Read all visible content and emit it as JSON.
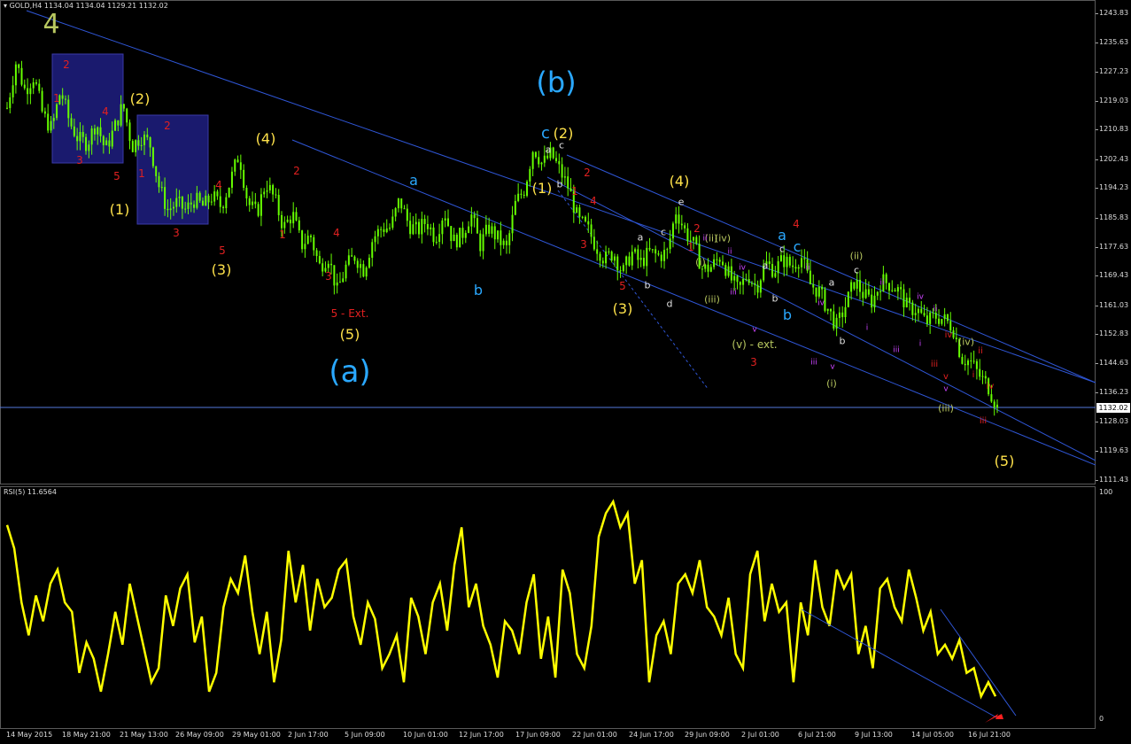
{
  "header": {
    "symbol": "GOLD,H4",
    "ohlc": "1134.04 1134.04 1129.21 1132.02"
  },
  "rsi_header": "RSI(5) 11.6564",
  "current_price": "1132.02",
  "colors": {
    "candle": "#66ff00",
    "rsi": "#ffff00",
    "channel": "#2f56d6",
    "box": "#1a1a6e",
    "red": "#e02020",
    "yellow": "#ffe24a",
    "blue": "#2aa8ff",
    "white": "#e0e0e0",
    "magenta": "#cc44ff",
    "olive": "#b8c860"
  },
  "chart_data": [
    {
      "type": "candlestick",
      "symbol": "GOLD",
      "timeframe": "H4",
      "y_ticks": [
        "1243.83",
        "1235.63",
        "1227.23",
        "1219.03",
        "1210.83",
        "1202.43",
        "1194.23",
        "1185.83",
        "1177.63",
        "1169.43",
        "1161.03",
        "1152.83",
        "1144.63",
        "1136.23",
        "1128.03",
        "1119.63",
        "1111.43"
      ],
      "x_ticks": [
        "14 May 2015",
        "18 May 21:00",
        "21 May 13:00",
        "26 May 09:00",
        "29 May 01:00",
        "2 Jun 17:00",
        "5 Jun 09:00",
        "10 Jun 01:00",
        "12 Jun 17:00",
        "17 Jun 09:00",
        "22 Jun 01:00",
        "24 Jun 17:00",
        "29 Jun 09:00",
        "2 Jul 01:00",
        "6 Jul 21:00",
        "9 Jul 13:00",
        "14 Jul 05:00",
        "16 Jul 21:00"
      ],
      "ylim": [
        1108,
        1246
      ],
      "close_path": [
        1217,
        1230,
        1222,
        1226,
        1215,
        1211,
        1222,
        1213,
        1208,
        1207,
        1213,
        1205,
        1211,
        1218,
        1206,
        1209,
        1207,
        1195,
        1188,
        1190,
        1188,
        1191,
        1189,
        1192,
        1189,
        1196,
        1204,
        1190,
        1187,
        1196,
        1191,
        1183,
        1187,
        1178,
        1181,
        1172,
        1175,
        1165,
        1172,
        1175,
        1171,
        1180,
        1183,
        1183,
        1191,
        1184,
        1182,
        1185,
        1180,
        1188,
        1179,
        1181,
        1187,
        1178,
        1183,
        1180,
        1177,
        1190,
        1194,
        1206,
        1201,
        1204,
        1199,
        1194,
        1185,
        1183,
        1178,
        1174,
        1176,
        1170,
        1176,
        1173,
        1176,
        1175,
        1176,
        1188,
        1182,
        1178,
        1171,
        1172,
        1175,
        1169,
        1165,
        1170,
        1166,
        1173,
        1171,
        1174,
        1172,
        1175,
        1167,
        1165,
        1160,
        1155,
        1161,
        1168,
        1164,
        1162,
        1168,
        1167,
        1165,
        1160,
        1160,
        1156,
        1158,
        1157,
        1155,
        1146,
        1145,
        1141,
        1138,
        1132
      ],
      "current_price": 1132.02,
      "channels": [
        {
          "from": [
            "14 May 2015",
            1243
          ],
          "to": [
            "16 Jul 21:00",
            1140
          ]
        },
        {
          "from": [
            "12 Jun 17:00",
            1187
          ],
          "to": [
            "16 Jul 21:00",
            1116
          ]
        },
        {
          "from": [
            "17 Jun 09:00",
            1202
          ],
          "to": [
            "16 Jul 21:00",
            1140
          ]
        }
      ],
      "wave_labels": [
        "4",
        "(b)",
        "(a)",
        "(5)",
        "(4)",
        "(3)",
        "(2)",
        "(1)",
        "5 - Ext.",
        "(v) - ext.",
        "a",
        "b",
        "c",
        "d",
        "e",
        "(i)",
        "(ii)",
        "(iii)",
        "(iv)",
        "i",
        "ii",
        "iii",
        "iv",
        "v",
        "1",
        "2",
        "3",
        "4",
        "5"
      ]
    },
    {
      "type": "line",
      "series": [
        {
          "name": "RSI(5)",
          "color": "#ffff00"
        }
      ],
      "ylim": [
        0,
        100
      ],
      "y_ticks": [
        "100",
        "0"
      ],
      "last_value": 11.6564,
      "values": [
        85,
        75,
        52,
        38,
        55,
        44,
        60,
        66,
        52,
        48,
        22,
        35,
        28,
        14,
        30,
        48,
        34,
        60,
        46,
        32,
        18,
        24,
        55,
        42,
        58,
        64,
        35,
        46,
        14,
        22,
        50,
        62,
        56,
        72,
        48,
        30,
        48,
        18,
        36,
        74,
        52,
        68,
        40,
        62,
        50,
        54,
        66,
        70,
        46,
        34,
        52,
        45,
        24,
        30,
        38,
        18,
        54,
        46,
        30,
        52,
        60,
        40,
        68,
        84,
        50,
        60,
        42,
        34,
        20,
        44,
        40,
        30,
        52,
        64,
        28,
        46,
        20,
        66,
        56,
        30,
        24,
        42,
        80,
        90,
        95,
        84,
        90,
        60,
        70,
        18,
        38,
        44,
        30,
        60,
        64,
        56,
        70,
        50,
        46,
        38,
        54,
        30,
        24,
        64,
        74,
        44,
        60,
        48,
        52,
        18,
        52,
        38,
        70,
        50,
        42,
        66,
        58,
        64,
        30,
        42,
        24,
        58,
        62,
        50,
        44,
        66,
        54,
        40,
        48,
        30,
        34,
        28,
        36,
        22,
        24,
        12,
        18,
        12
      ]
    }
  ]
}
